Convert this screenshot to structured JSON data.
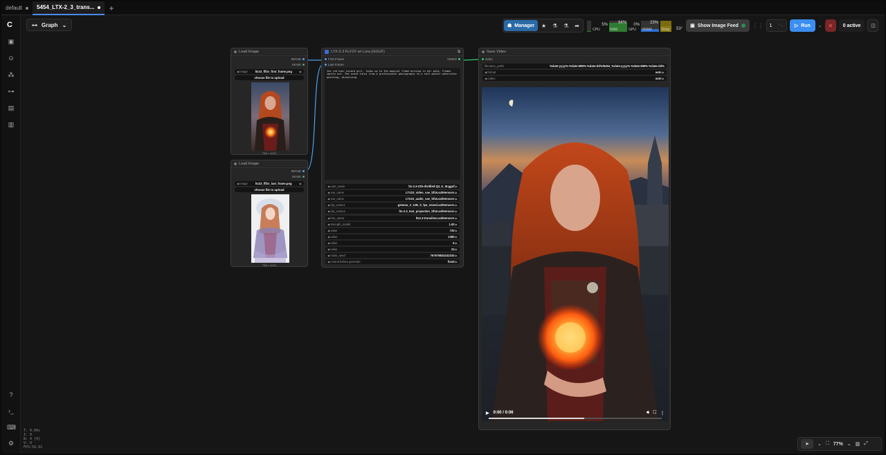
{
  "tabs": [
    {
      "label": "default",
      "active": false
    },
    {
      "label": "5454_LTX-2_3_trans...",
      "active": true
    }
  ],
  "graph_button": {
    "label": "Graph"
  },
  "toolbar": {
    "manager_label": "Manager",
    "cpu": {
      "label": "CPU",
      "value": "5%",
      "fill": 0.05
    },
    "ram": {
      "label": "RAM",
      "value": "84%",
      "fill": 0.84
    },
    "gpu": {
      "label": "GPU",
      "value": "0%",
      "fill": 0.0
    },
    "vram": {
      "label": "VRAM",
      "value": "23%",
      "fill": 0.23
    },
    "temp": {
      "label": "Temp",
      "value": "53°",
      "fill": 0.53
    },
    "show_image_feed": "Show Image Feed",
    "queue_count": "1",
    "run_label": "Run",
    "active_label": "0 active"
  },
  "nodes": {
    "load_image_1": {
      "title": "Load Image",
      "out_image": "IMAGE",
      "out_mask": "MASK",
      "image_label": "image",
      "image_value": "ltx23_flf2v_first_frame.png",
      "upload": "choose file to upload",
      "dims": "768 × 1024"
    },
    "load_image_2": {
      "title": "Load Image",
      "out_image": "IMAGE",
      "out_mask": "MASK",
      "image_label": "image",
      "image_value": "ltx23_flf2v_last_frame.png",
      "upload": "choose file to upload",
      "dims": "768 × 1024"
    },
    "ltx": {
      "title": "LTX-2.3 FLF2V w/ Lora (GGUF)",
      "in_first": "First Frame",
      "in_last": "Last Frame",
      "out_video": "VIDEO",
      "prompt": "the red hair wizard girl, looks up to the magical flame burning in her palm, flames ignite out. The scene turns from a professional photography to a soft pastel watercolor painting, dissolving",
      "widgets": [
        {
          "label": "unet_name",
          "value": "ltx-2.3-22b-distilled-Q4_K_M.gguf"
        },
        {
          "label": "vae_name",
          "value": "LTX23_video_vae_bf16.safetensors"
        },
        {
          "label": "vae_name",
          "value": "LTX23_audio_vae_bf16.safetensors"
        },
        {
          "label": "clip_name1",
          "value": "gemma_3_12B_it_fp4_mixed.safetensors"
        },
        {
          "label": "clip_name2",
          "value": "ltx-2.3_text_projection_bf16.safetensors"
        },
        {
          "label": "lora_name",
          "value": "ltx2.3-transition.safetensors"
        },
        {
          "label": "strength_model",
          "value": "1.00"
        },
        {
          "label": "value",
          "value": "720"
        },
        {
          "label": "value",
          "value": "1280"
        },
        {
          "label": "value",
          "value": "6"
        },
        {
          "label": "value",
          "value": "24"
        },
        {
          "label": "noise_seed",
          "value": "767678824242333"
        },
        {
          "label": "control before generate",
          "value": "fixed"
        }
      ]
    },
    "save_video": {
      "title": "Save Video",
      "in_video": "video",
      "widgets": [
        {
          "label": "filename_prefix",
          "value": "%date:yyyy%-%date:MM%-%date:dd%/5454_%date:yyyy%-%date:MM%-%date:dd%"
        },
        {
          "label": "format",
          "value": "auto"
        },
        {
          "label": "codec",
          "value": "auto"
        }
      ],
      "time": "0:00 / 0:06",
      "progress": 0.55
    }
  },
  "stats": {
    "lines": [
      "T: 0.00s",
      "I: 0",
      "N: 4 [4]",
      "V: 0",
      "FPS:59.92"
    ]
  },
  "zoom": "77%",
  "colors": {
    "accent": "#3b8ef0",
    "image_link": "#4aa3f0",
    "video_link": "#2ecc71"
  }
}
